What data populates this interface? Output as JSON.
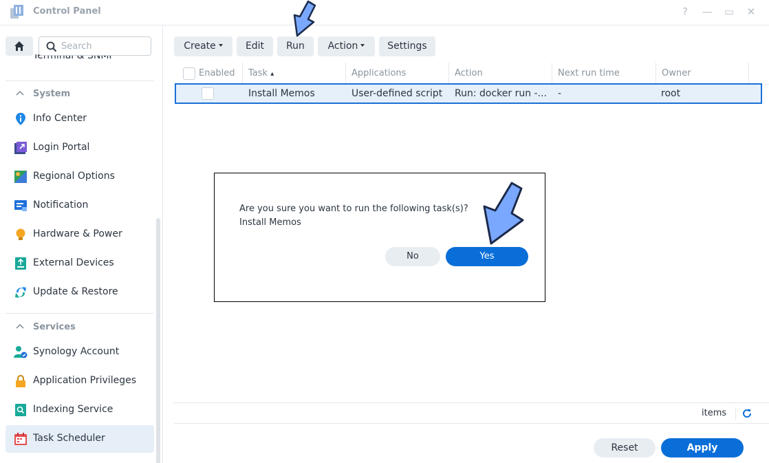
{
  "window": {
    "title": "Control Panel",
    "controls": [
      "?",
      "—",
      "▭",
      "✕"
    ]
  },
  "sidebar": {
    "search_placeholder": "Search",
    "partial_item": "Terminal & SNMP",
    "sections": [
      {
        "header": "System",
        "items": [
          {
            "label": "Info Center",
            "icon": "info-icon"
          },
          {
            "label": "Login Portal",
            "icon": "login-portal-icon"
          },
          {
            "label": "Regional Options",
            "icon": "regional-options-icon"
          },
          {
            "label": "Notification",
            "icon": "notification-icon"
          },
          {
            "label": "Hardware & Power",
            "icon": "lightbulb-icon"
          },
          {
            "label": "External Devices",
            "icon": "external-devices-icon"
          },
          {
            "label": "Update & Restore",
            "icon": "update-restore-icon"
          }
        ]
      },
      {
        "header": "Services",
        "items": [
          {
            "label": "Synology Account",
            "icon": "synology-account-icon"
          },
          {
            "label": "Application Privileges",
            "icon": "lock-icon"
          },
          {
            "label": "Indexing Service",
            "icon": "indexing-service-icon"
          },
          {
            "label": "Task Scheduler",
            "icon": "calendar-icon",
            "active": true
          }
        ]
      }
    ]
  },
  "toolbar": {
    "create_label": "Create",
    "edit_label": "Edit",
    "run_label": "Run",
    "action_label": "Action",
    "settings_label": "Settings"
  },
  "table": {
    "columns": [
      "Enabled",
      "Task",
      "Applications",
      "Action",
      "Next run time",
      "Owner"
    ],
    "sort_indicator": "▴",
    "rows": [
      {
        "task": "Install Memos",
        "applications": "User-defined script",
        "action": "Run: docker run -...",
        "next_run": "-",
        "owner": "root",
        "selected": true
      }
    ]
  },
  "footer": {
    "items_label": "items",
    "reset_label": "Reset",
    "apply_label": "Apply"
  },
  "dialog": {
    "message_line1": "Are you sure you want to run the following task(s)?",
    "message_line2": "Install Memos",
    "no_label": "No",
    "yes_label": "Yes"
  },
  "colors": {
    "accent": "#0a6ed8",
    "selection": "#e6f0fb",
    "annotation_arrow": "#7aa8ff"
  }
}
